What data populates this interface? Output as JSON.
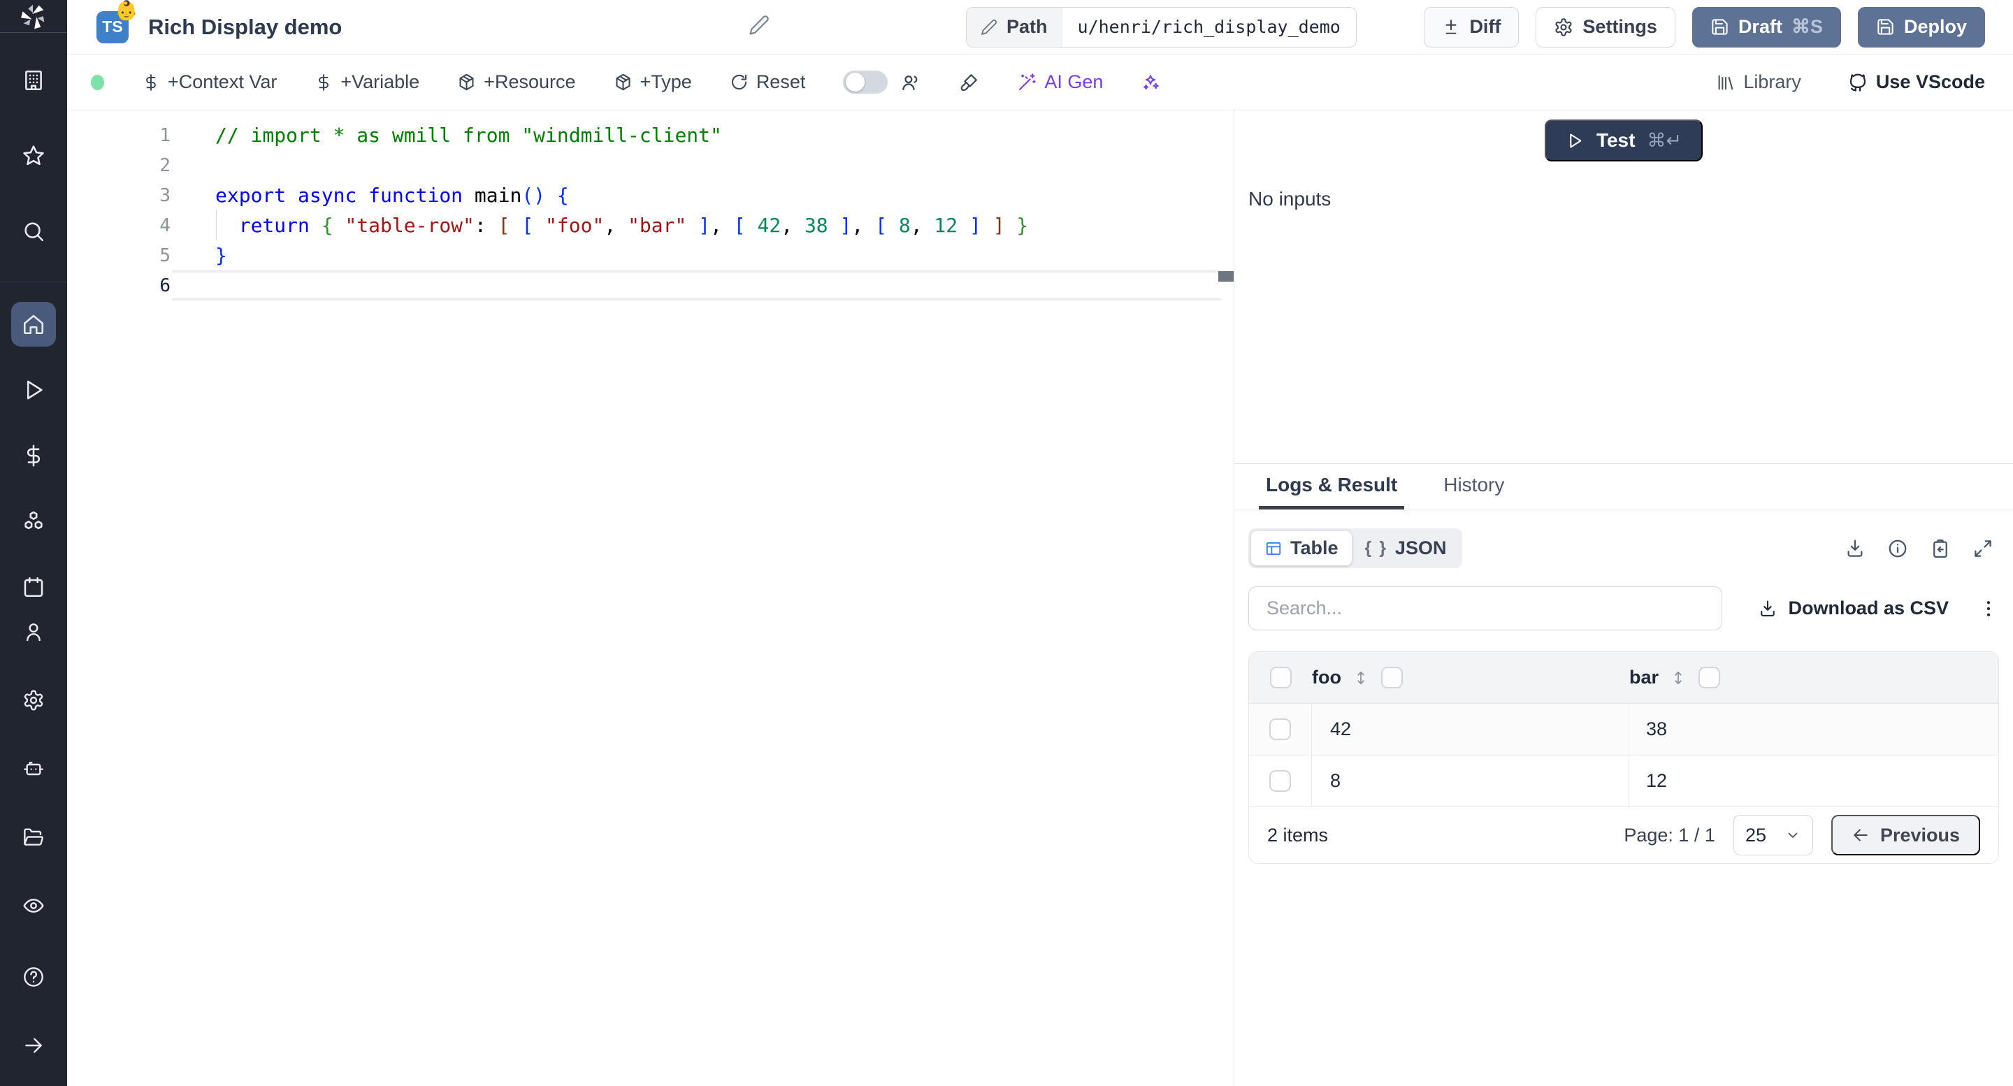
{
  "header": {
    "title": "Rich Display demo",
    "lang_badge": "TS",
    "emoji": "👶",
    "path": {
      "label": "Path",
      "value": "u/henri/rich_display_demo"
    },
    "buttons": {
      "diff": "Diff",
      "settings": "Settings",
      "draft": "Draft",
      "draft_shortcut": "⌘S",
      "deploy": "Deploy"
    }
  },
  "toolbar": {
    "add_context_var": "+Context Var",
    "add_variable": "+Variable",
    "add_resource": "+Resource",
    "add_type": "+Type",
    "reset": "Reset",
    "ai_gen": "AI Gen",
    "library": "Library",
    "use_vscode": "Use VScode"
  },
  "editor": {
    "lines": [
      {
        "num": "1",
        "tokens": [
          {
            "t": "// import * as wmill from \"windmill-client\"",
            "c": "comment"
          }
        ]
      },
      {
        "num": "2",
        "tokens": []
      },
      {
        "num": "3",
        "tokens": [
          {
            "t": "export",
            "c": "kw"
          },
          {
            "t": " ",
            "c": "pl"
          },
          {
            "t": "async",
            "c": "kw"
          },
          {
            "t": " ",
            "c": "pl"
          },
          {
            "t": "function",
            "c": "kw"
          },
          {
            "t": " ",
            "c": "pl"
          },
          {
            "t": "main",
            "c": "fn"
          },
          {
            "t": "(",
            "c": "b1"
          },
          {
            "t": ")",
            "c": "b1"
          },
          {
            "t": " ",
            "c": "pl"
          },
          {
            "t": "{",
            "c": "b1"
          }
        ]
      },
      {
        "num": "4",
        "guide": true,
        "tokens": [
          {
            "t": "  ",
            "c": "pl"
          },
          {
            "t": "return",
            "c": "kw"
          },
          {
            "t": " ",
            "c": "pl"
          },
          {
            "t": "{",
            "c": "b2"
          },
          {
            "t": " ",
            "c": "pl"
          },
          {
            "t": "\"table-row\"",
            "c": "str"
          },
          {
            "t": ": ",
            "c": "pl"
          },
          {
            "t": "[",
            "c": "b3"
          },
          {
            "t": " ",
            "c": "pl"
          },
          {
            "t": "[",
            "c": "b1"
          },
          {
            "t": " ",
            "c": "pl"
          },
          {
            "t": "\"foo\"",
            "c": "str"
          },
          {
            "t": ", ",
            "c": "pl"
          },
          {
            "t": "\"bar\"",
            "c": "str"
          },
          {
            "t": " ",
            "c": "pl"
          },
          {
            "t": "]",
            "c": "b1"
          },
          {
            "t": ", ",
            "c": "pl"
          },
          {
            "t": "[",
            "c": "b1"
          },
          {
            "t": " ",
            "c": "pl"
          },
          {
            "t": "42",
            "c": "num"
          },
          {
            "t": ", ",
            "c": "pl"
          },
          {
            "t": "38",
            "c": "num"
          },
          {
            "t": " ",
            "c": "pl"
          },
          {
            "t": "]",
            "c": "b1"
          },
          {
            "t": ", ",
            "c": "pl"
          },
          {
            "t": "[",
            "c": "b1"
          },
          {
            "t": " ",
            "c": "pl"
          },
          {
            "t": "8",
            "c": "num"
          },
          {
            "t": ", ",
            "c": "pl"
          },
          {
            "t": "12",
            "c": "num"
          },
          {
            "t": " ",
            "c": "pl"
          },
          {
            "t": "]",
            "c": "b1"
          },
          {
            "t": " ",
            "c": "pl"
          },
          {
            "t": "]",
            "c": "b3"
          },
          {
            "t": " ",
            "c": "pl"
          },
          {
            "t": "}",
            "c": "b2"
          }
        ]
      },
      {
        "num": "5",
        "tokens": [
          {
            "t": "}",
            "c": "b1"
          }
        ]
      },
      {
        "num": "6",
        "current": true,
        "tokens": []
      }
    ]
  },
  "run_panel": {
    "test_label": "Test",
    "test_shortcut": "⌘↵",
    "empty_text": "No inputs"
  },
  "result_panel": {
    "tabs": [
      {
        "label": "Logs & Result",
        "active": true
      },
      {
        "label": "History",
        "active": false
      }
    ],
    "views": [
      {
        "label": "Table",
        "active": true
      },
      {
        "label": "JSON",
        "active": false
      }
    ],
    "braces_glyph": "{ }",
    "search_placeholder": "Search...",
    "download_csv_label": "Download as CSV",
    "table": {
      "columns": [
        "foo",
        "bar"
      ],
      "rows": [
        [
          "42",
          "38"
        ],
        [
          "8",
          "12"
        ]
      ],
      "footer": {
        "items_label": "2 items",
        "page_label": "Page: 1 / 1",
        "page_size": "25",
        "previous_label": "Previous"
      }
    }
  },
  "colors": {
    "sidebar_bg": "#21252f",
    "active_nav": "#4a5a7d",
    "slate_button": "#5e7296",
    "test_button": "#2e3c58",
    "ai_purple": "#7c3aed",
    "status_green": "#7ee2a8",
    "ts_blue": "#3e81c8",
    "table_icon_blue": "#3b82f6"
  }
}
